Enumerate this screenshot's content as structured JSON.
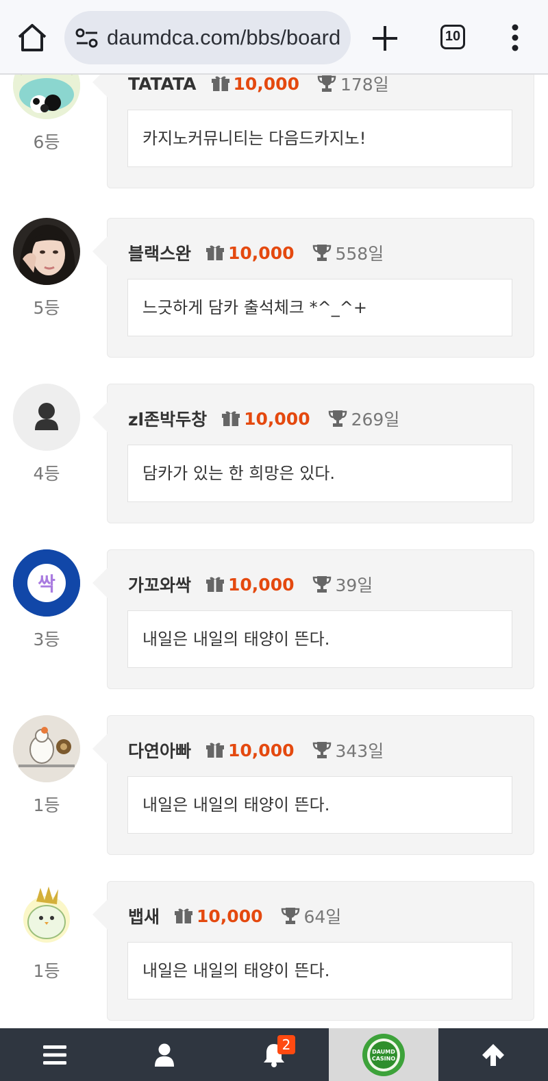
{
  "browser": {
    "url": "daumdca.com/bbs/board",
    "tab_count": "10"
  },
  "entries": [
    {
      "rank": "6등",
      "nickname": "TATATA",
      "points": "10,000",
      "days": "178일",
      "message": "카지노커뮤니티는 다음드카지노!",
      "avatar": "panda-avatar"
    },
    {
      "rank": "5등",
      "nickname": "블랙스완",
      "points": "10,000",
      "days": "558일",
      "message": "느긋하게 담카 출석체크 *^_^+",
      "avatar": "woman-photo-avatar"
    },
    {
      "rank": "4등",
      "nickname": "zl존박두창",
      "points": "10,000",
      "days": "269일",
      "message": "담카가 있는 한 희망은 있다.",
      "avatar": "default-user-avatar"
    },
    {
      "rank": "3등",
      "nickname": "가꼬와싹",
      "points": "10,000",
      "days": "39일",
      "message": "내일은 내일의 태양이 뜬다.",
      "avatar": "ssak-text-avatar",
      "avatar_text": "싹"
    },
    {
      "rank": "1등",
      "nickname": "다연아빠",
      "points": "10,000",
      "days": "343일",
      "message": "내일은 내일의 태양이 뜬다.",
      "avatar": "hamster-sketch-avatar"
    },
    {
      "rank": "1등",
      "nickname": "뱁새",
      "points": "10,000",
      "days": "64일",
      "message": "내일은 내일의 태양이 뜬다.",
      "avatar": "bird-avatar"
    }
  ],
  "bottom_nav": {
    "items": [
      "menu-icon",
      "user-icon",
      "bell-icon",
      "daumd-casino-logo",
      "arrow-up-icon"
    ],
    "notification_count": "2",
    "logo_text_line1": "DAUMD",
    "logo_text_line2": "CASINO"
  },
  "colors": {
    "points": "#e4490f",
    "nav_bg": "#2f3640",
    "badge": "#ff4a11"
  }
}
